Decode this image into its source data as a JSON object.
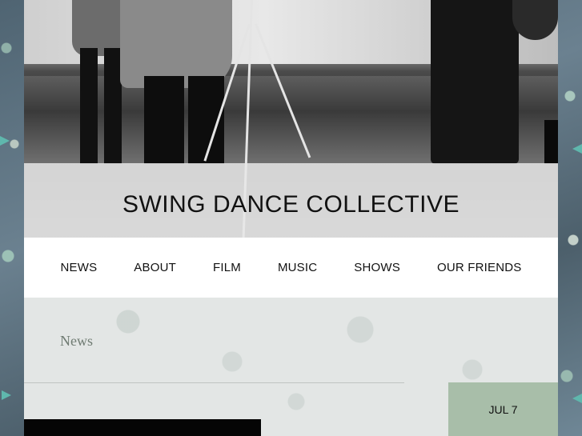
{
  "site": {
    "title": "SWING DANCE COLLECTIVE"
  },
  "nav": {
    "items": [
      {
        "label": "NEWS"
      },
      {
        "label": "ABOUT"
      },
      {
        "label": "FILM"
      },
      {
        "label": "MUSIC"
      },
      {
        "label": "SHOWS"
      },
      {
        "label": "OUR FRIENDS"
      }
    ]
  },
  "main": {
    "section_heading": "News",
    "post": {
      "date": "JUL 7"
    }
  },
  "colors": {
    "nav_background": "#ffffff",
    "content_background": "#e3e6e5",
    "date_badge": "#a8bea9",
    "heading_text": "#6f7b72"
  }
}
